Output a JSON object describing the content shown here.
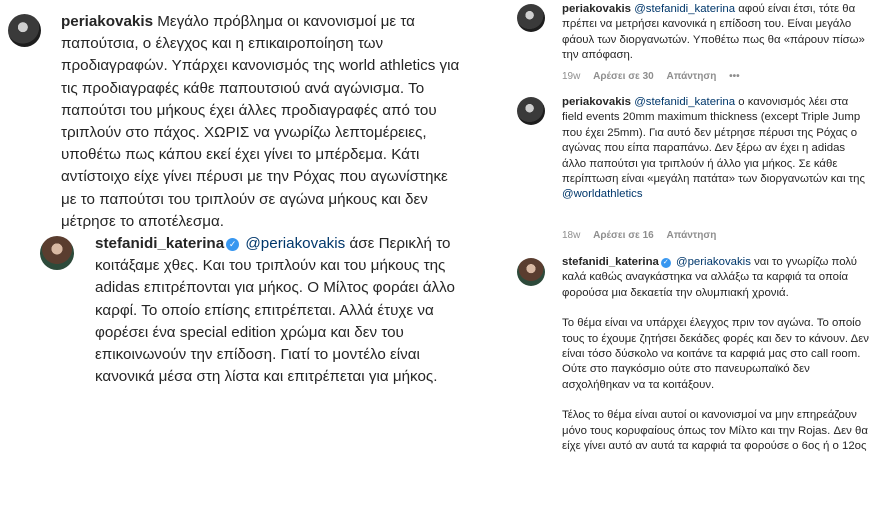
{
  "left_comments": [
    {
      "username": "periakovakis",
      "text": "Μεγάλο πρόβλημα οι κανονισμοί με τα παπούτσια, ο έλεγχος και η επικαιροποίηση των προδιαγραφών. Υπάρχει κανονισμός της world athletics για τις προδιαγραφές κάθε παπουτσιού ανά αγώνισμα. Το παπούτσι του μήκους έχει άλλες προδιαγραφές από του τριπλούν στο πάχος. ΧΩΡΙΣ να γνωρίζω λεπτομέρειες, υποθέτω πως κάπου εκεί έχει γίνει το μπέρδεμα. Κάτι αντίστοιχο είχε γίνει πέρυσι με την Ρόχας που αγωνίστηκε με το παπούτσι του τριπλούν σε αγώνα μήκους και δεν μέτρησε το αποτέλεσμα."
    },
    {
      "username": "stefanidi_katerina",
      "verified": "✓",
      "mention": "@periakovakis",
      "text": " άσε Περικλή το κοιτάξαμε χθες. Και του τριπλούν και του μήκους της adidas επιτρέπονται για μήκος. Ο Μίλτος φοράει άλλο καρφί. Το οποίο επίσης επιτρέπεται. Αλλά έτυχε να φορέσει ένα special edition χρώμα και δεν του επικοινωνούν την επίδοση. Γιατί το μοντέλο είναι κανονικά μέσα στη λίστα και επιτρέπεται για μήκος."
    }
  ],
  "right_comments": [
    {
      "username": "periakovakis",
      "mention": "@stefanidi_katerina",
      "text": " αφού είναι έτσι, τότε θα πρέπει να μετρήσει κανονικά η επίδοση του. Είναι μεγάλο φάουλ των διοργανωτών. Υποθέτω πως θα «πάρουν πίσω» την απόφαση.",
      "time": "19w",
      "likes": "Αρέσει σε 30",
      "reply": "Απάντηση",
      "more": "•••"
    },
    {
      "username": "periakovakis",
      "mention": "@stefanidi_katerina",
      "text": " ο κανονισμός λέει στα field events 20mm maximum thickness (except Triple Jump που έχει 25mm). Για αυτό δεν μέτρησε πέρυσι της Ρόχας ο αγώνας που είπα παραπάνω. Δεν ξέρω αν έχει η adidas άλλο παπούτσι για τριπλούν ή άλλο για μήκος. Σε κάθε περίπτωση είναι «μεγάλη πατάτα» των διοργανωτών και της ",
      "mention2": "@worldathletics",
      "time": "18w",
      "likes": "Αρέσει σε 16",
      "reply": "Απάντηση"
    },
    {
      "username": "stefanidi_katerina",
      "verified": "✓",
      "mention": "@periakovakis",
      "text": " ναι το γνωρίζω πολύ καλά καθώς αναγκάστηκα να αλλάξω τα καρφιά τα οποία φορούσα μια δεκαετία την ολυμπιακή χρονιά.",
      "p2": "Το θέμα είναι να υπάρχει έλεγχος πριν τον αγώνα. Το οποίο τους το έχουμε ζητήσει δεκάδες φορές και δεν το κάνουν. Δεν είναι τόσο δύσκολο να κοιτάνε τα καρφιά μας στο call room. Ούτε στο παγκόσμιο ούτε στο πανευρωπαϊκό δεν ασχολήθηκαν να τα κοιτάξουν.",
      "p3": "Τέλος το θέμα είναι αυτοί οι κανονισμοί να μην επηρεάζουν μόνο τους κορυφαίους όπως τον Μίλτο και την Rojas. Δεν θα είχε γίνει αυτό αν αυτά τα καρφιά τα φορούσε ο 6ος ή ο 12ος"
    }
  ]
}
